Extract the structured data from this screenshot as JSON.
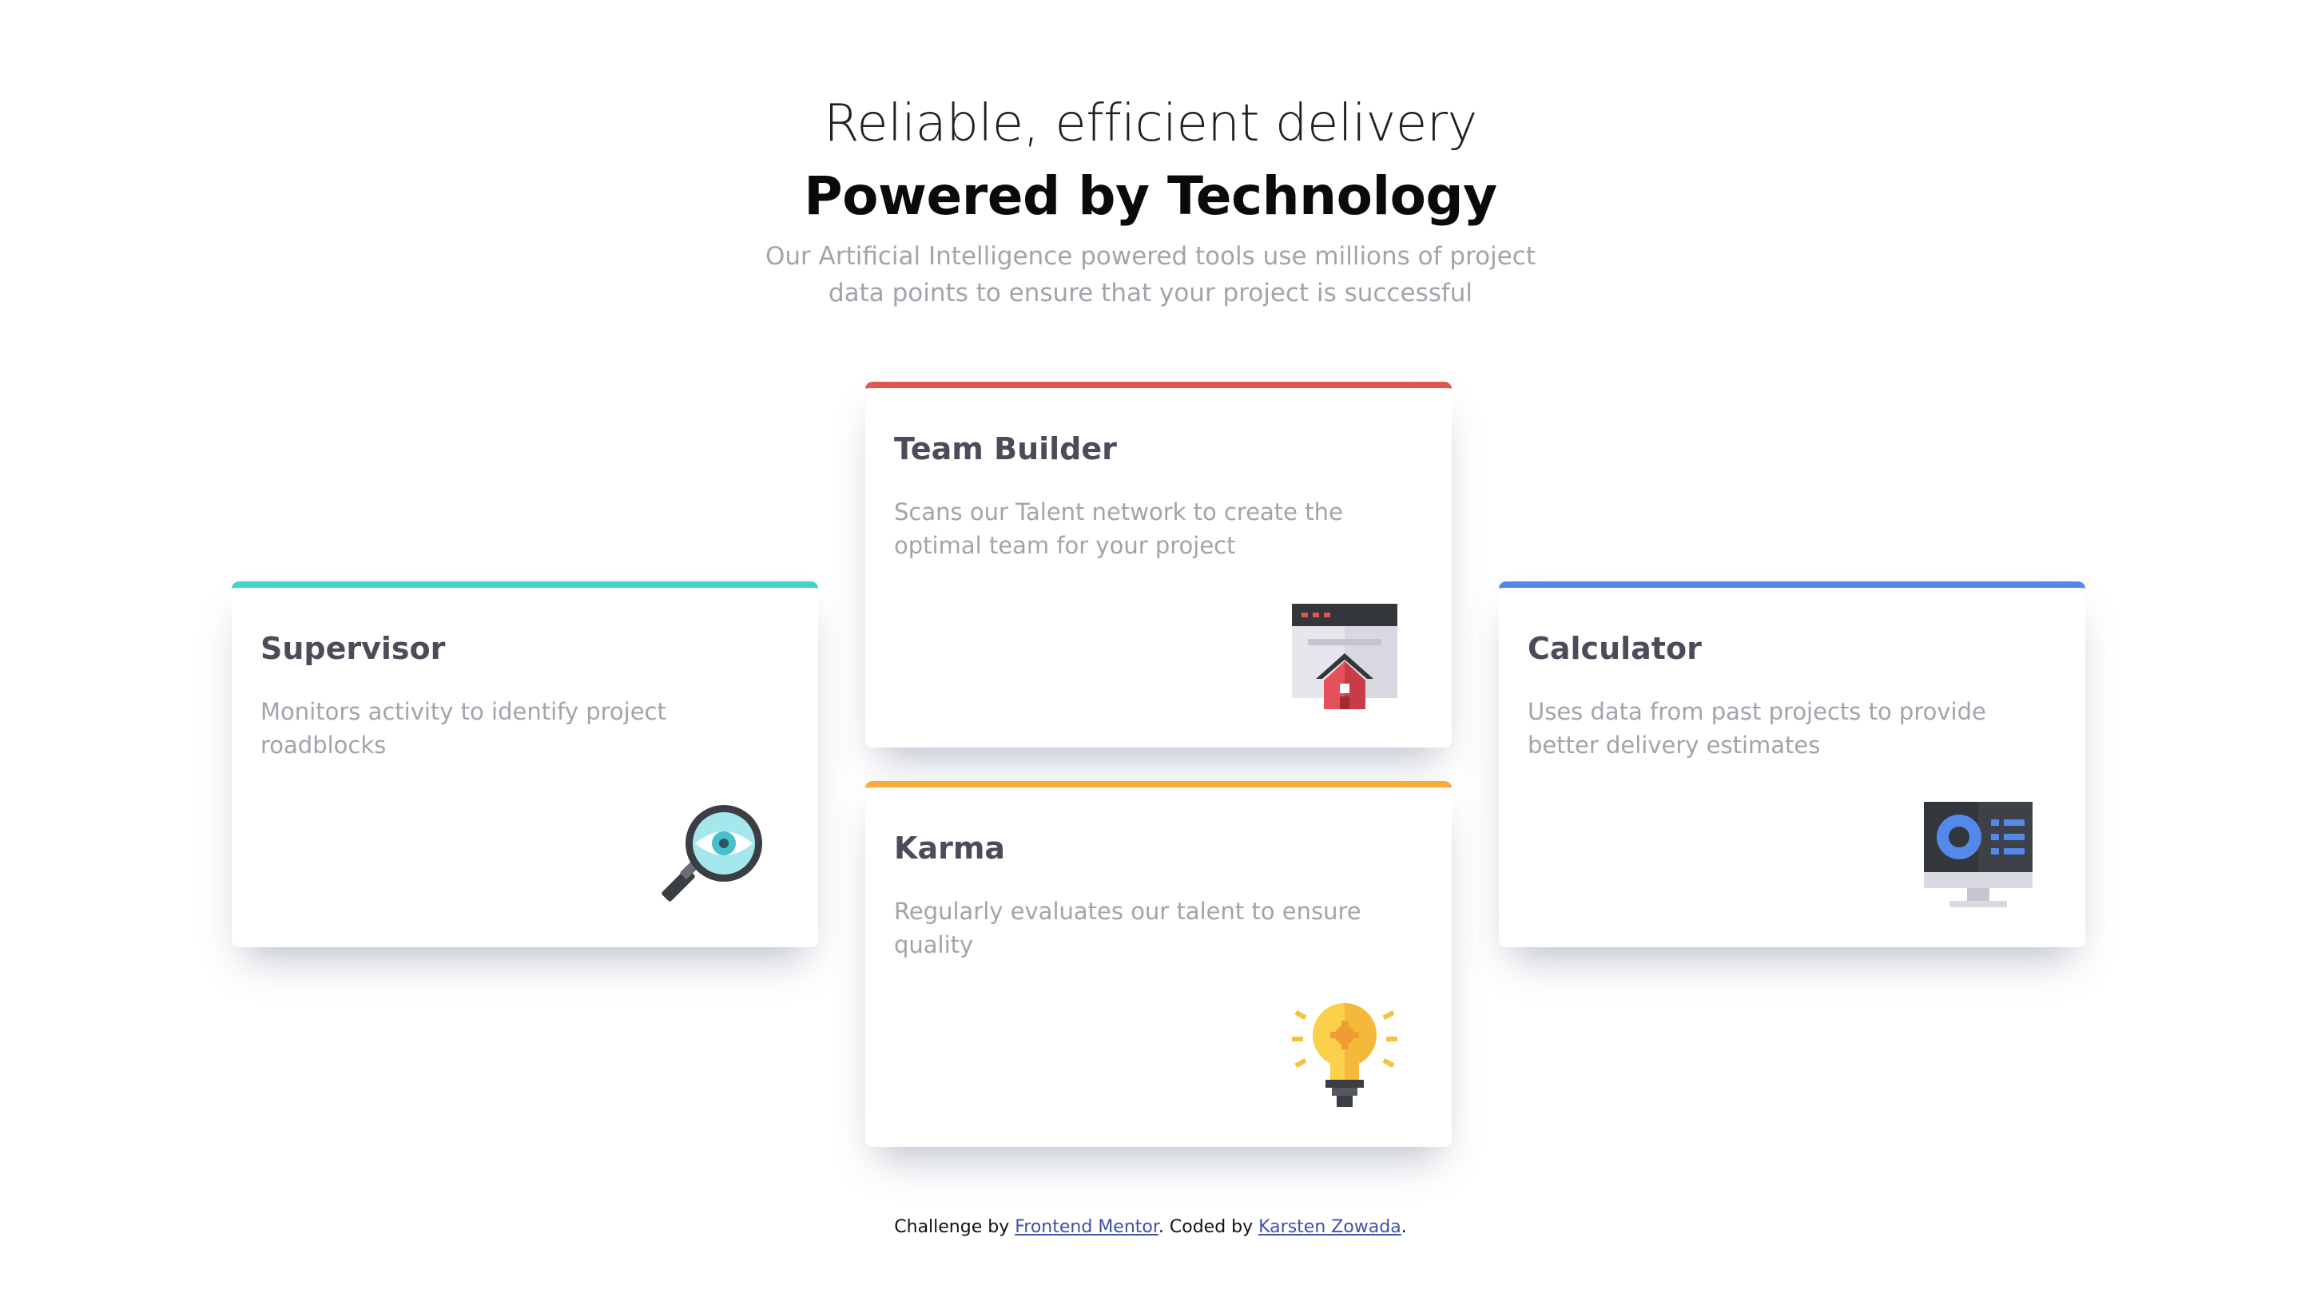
{
  "header": {
    "title_light": "Reliable, efficient delivery",
    "title_bold": "Powered by Technology",
    "subtitle": "Our Artificial Intelligence powered tools use millions of project data points to ensure that your project is successful"
  },
  "cards": {
    "supervisor": {
      "title": "Supervisor",
      "text": "Monitors activity to identify project roadblocks",
      "accent": "#45d3c6",
      "icon": "magnifier-eye-icon"
    },
    "team_builder": {
      "title": "Team Builder",
      "text": "Scans our Talent network to create the optimal team for your project",
      "accent": "#e1564f",
      "icon": "browser-house-icon"
    },
    "karma": {
      "title": "Karma",
      "text": "Regularly evaluates our talent to ensure quality",
      "accent": "#fca93a",
      "icon": "lightbulb-icon"
    },
    "calculator": {
      "title": "Calculator",
      "text": "Uses data from past projects to provide better delivery estimates",
      "accent": "#5489e9",
      "icon": "monitor-chart-icon"
    }
  },
  "footer": {
    "challenge_prefix": "Challenge by ",
    "challenge_link": "Frontend Mentor",
    "coded_prefix": ". Coded by ",
    "coded_link": "Karsten Zowada",
    "suffix": "."
  }
}
